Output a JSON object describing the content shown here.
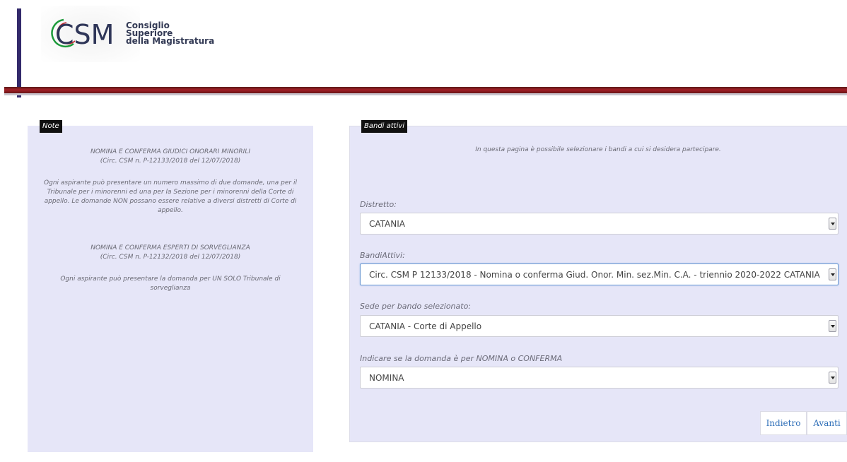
{
  "header": {
    "logo_abbr": "CSM",
    "logo_line1": "Consiglio",
    "logo_line2": "Superiore",
    "logo_line3": "della Magistratura"
  },
  "note_panel": {
    "tag": "Note",
    "block1_title": "NOMINA E CONFERMA GIUDICI ONORARI MINORILI",
    "block1_circ": "(Circ. CSM n. P-12133/2018 del 12/07/2018)",
    "block1_body": "Ogni aspirante può presentare un numero massimo di due domande, una per il Tribunale per i minorenni ed una per la Sezione per i minorenni della Corte di appello. Le domande NON possano essere relative a diversi distretti di Corte di appello.",
    "block2_title": "NOMINA E CONFERMA ESPERTI DI SORVEGLIANZA",
    "block2_circ": "(Circ. CSM n. P-12132/2018 del 12/07/2018)",
    "block2_body": "Ogni aspirante può presentare la domanda per UN SOLO Tribunale di sorveglianza"
  },
  "bandi_panel": {
    "tag": "Bandi attivi",
    "intro": "In questa pagina è possibile selezionare i bandi a cui si desidera partecipare.",
    "distretto_label": "Distretto:",
    "distretto_value": "CATANIA",
    "bandi_label": "BandiAttivi:",
    "bandi_value": "Circ. CSM P 12133/2018 - Nomina o conferma Giud. Onor. Min. sez.Min. C.A. - triennio 2020-2022 CATANIA",
    "sede_label": "Sede per bando selezionato:",
    "sede_value": "CATANIA - Corte di Appello",
    "tipo_label": "Indicare se la domanda è per NOMINA o CONFERMA",
    "tipo_value": "NOMINA",
    "back_label": "Indietro",
    "next_label": "Avanti"
  }
}
